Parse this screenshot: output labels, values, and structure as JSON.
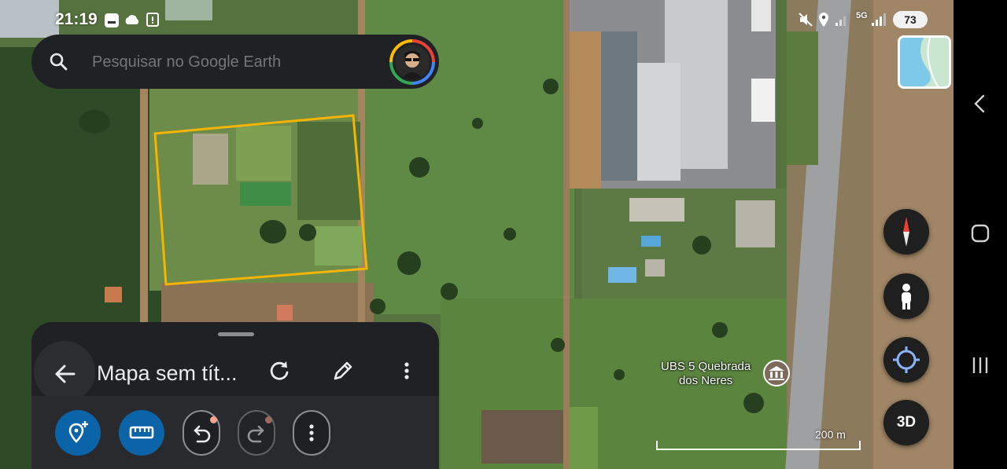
{
  "status_bar": {
    "time": "21:19",
    "battery": "73",
    "network": "5G"
  },
  "search": {
    "placeholder": "Pesquisar no Google Earth",
    "search_icon": "search-icon",
    "account_icon": "avatar"
  },
  "map": {
    "place_label_line1": "UBS 5 Quebrada",
    "place_label_line2": "dos Neres",
    "scale_label": "200 m",
    "polygon_color": "#f5b400"
  },
  "controls": {
    "layers_icon": "map-layers-thumbnail",
    "compass_icon": "compass-icon",
    "street_view_icon": "pegman-icon",
    "my_location_icon": "my-location-icon",
    "view_3d_label": "3D"
  },
  "sheet": {
    "title": "Mapa sem tít...",
    "back_icon": "arrow-back-icon",
    "refresh_icon": "refresh-icon",
    "edit_icon": "pencil-icon",
    "more_icon": "more-vert-icon",
    "actions": [
      "add-place-icon",
      "ruler-icon",
      "undo-icon",
      "redo-icon",
      "more-vert-icon"
    ],
    "accent": "#0b63a8"
  },
  "nav_bar": {
    "back_icon": "nav-back-icon",
    "home_icon": "nav-home-icon",
    "recents_icon": "nav-recents-icon"
  }
}
